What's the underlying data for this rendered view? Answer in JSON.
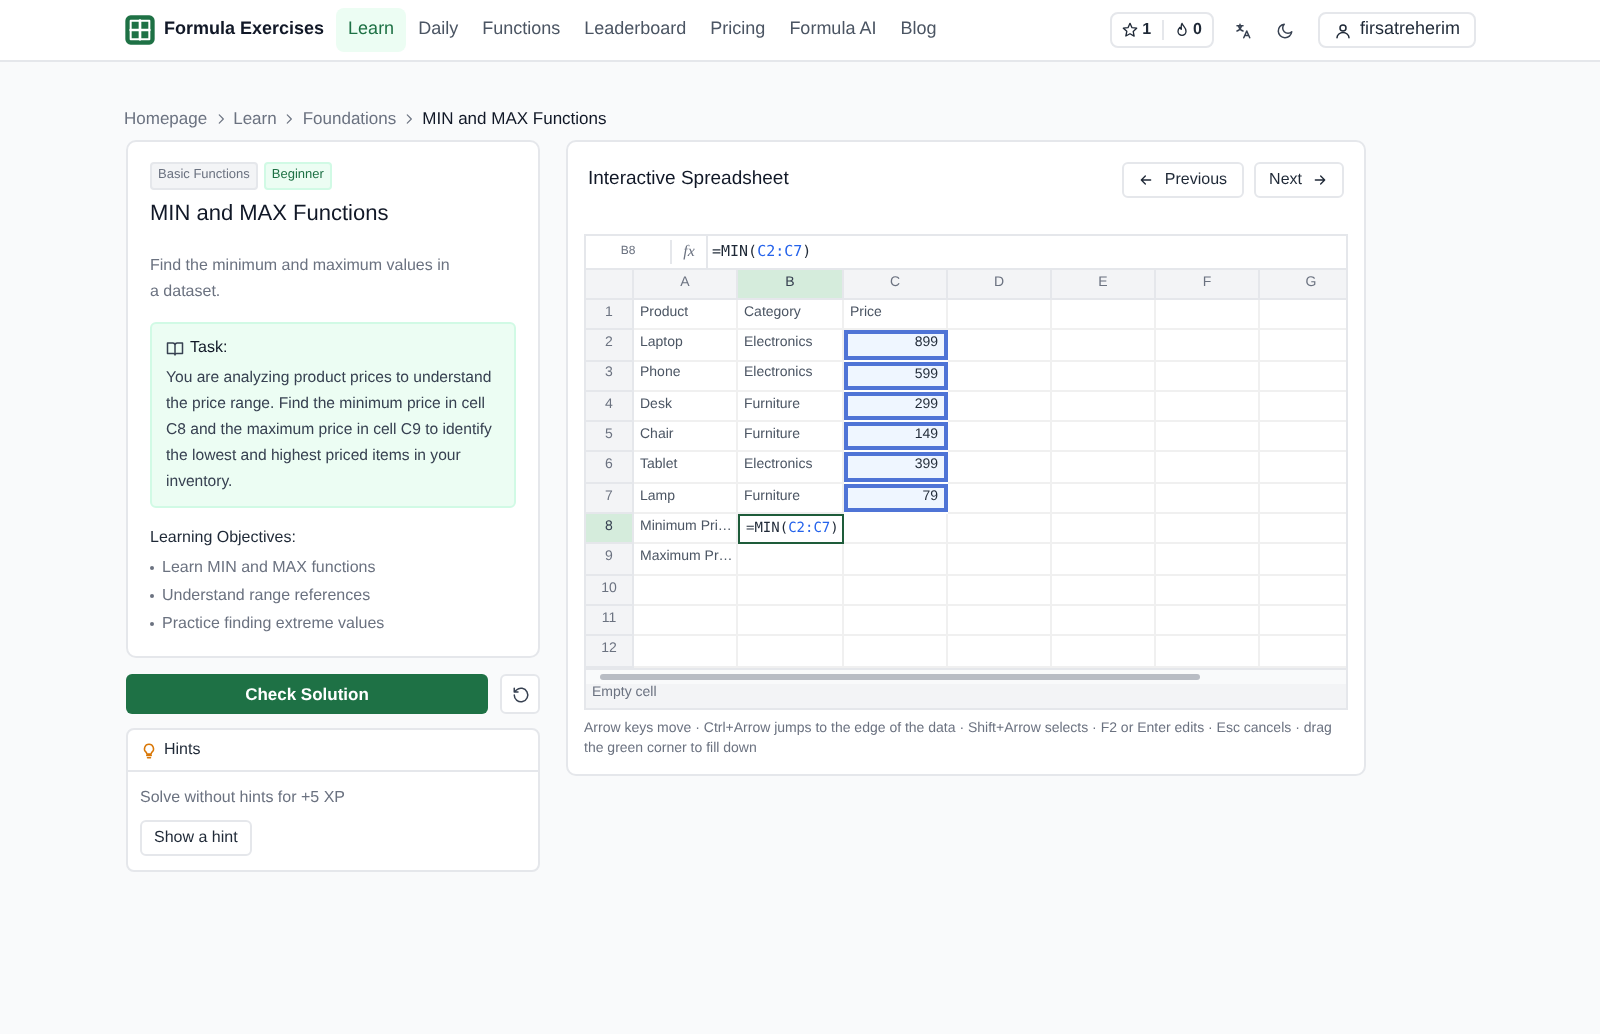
{
  "nav": {
    "brand": "Formula Exercises",
    "links": [
      {
        "label": "Learn",
        "selected": true
      },
      {
        "label": "Daily",
        "selected": false
      },
      {
        "label": "Functions",
        "selected": false
      },
      {
        "label": "Leaderboard",
        "selected": false
      },
      {
        "label": "Pricing",
        "selected": false
      },
      {
        "label": "Formula AI",
        "selected": false
      },
      {
        "label": "Blog",
        "selected": false
      }
    ],
    "stars": "1",
    "streak": "0",
    "user": "firsatreherim"
  },
  "breadcrumb": [
    "Homepage",
    "Learn",
    "Foundations",
    "MIN and MAX Functions"
  ],
  "lesson": {
    "tags": [
      {
        "label": "Basic Functions",
        "kind": "category"
      },
      {
        "label": "Beginner",
        "kind": "level"
      }
    ],
    "title": "MIN and MAX Functions",
    "description": "Find the minimum and maximum values in a dataset.",
    "task": {
      "title": "Task:",
      "text": "You are analyzing product prices to understand the price range. Find the minimum price in cell C8 and the maximum price in cell C9 to identify the lowest and highest priced items in your inventory."
    },
    "objectives_title": "Learning Objectives:",
    "objectives": [
      "Learn MIN and MAX functions",
      "Understand range references",
      "Practice finding extreme values"
    ]
  },
  "check_button": "Check Solution",
  "hints": {
    "title": "Hints",
    "note": "Solve without hints for +5 XP",
    "button": "Show a hint"
  },
  "spreadsheet": {
    "title": "Interactive Spreadsheet",
    "previous": "Previous",
    "next": "Next",
    "name_box": "B8",
    "fx": "fx",
    "formula": [
      {
        "text": "=MIN(",
        "kind": "plain"
      },
      {
        "text": "C2:C7",
        "kind": "ref"
      },
      {
        "text": ")",
        "kind": "plain"
      }
    ],
    "columns": [
      {
        "label": "A",
        "selected": false
      },
      {
        "label": "B",
        "selected": true
      },
      {
        "label": "C",
        "selected": false
      },
      {
        "label": "D",
        "selected": false
      },
      {
        "label": "E",
        "selected": false
      },
      {
        "label": "F",
        "selected": false
      },
      {
        "label": "G",
        "selected": false
      }
    ],
    "rows": [
      {
        "label": "1",
        "selected": false,
        "cells": [
          {
            "kind": "text",
            "text": "Product"
          },
          {
            "kind": "text",
            "text": "Category"
          },
          {
            "kind": "text",
            "text": "Price"
          },
          {
            "kind": "empty"
          },
          {
            "kind": "empty"
          },
          {
            "kind": "empty"
          },
          {
            "kind": "empty"
          }
        ]
      },
      {
        "label": "2",
        "selected": false,
        "cells": [
          {
            "kind": "text",
            "text": "Laptop"
          },
          {
            "kind": "text",
            "text": "Electronics"
          },
          {
            "kind": "range",
            "text": "899"
          },
          {
            "kind": "empty"
          },
          {
            "kind": "empty"
          },
          {
            "kind": "empty"
          },
          {
            "kind": "empty"
          }
        ]
      },
      {
        "label": "3",
        "selected": false,
        "cells": [
          {
            "kind": "text",
            "text": "Phone"
          },
          {
            "kind": "text",
            "text": "Electronics"
          },
          {
            "kind": "range",
            "text": "599"
          },
          {
            "kind": "empty"
          },
          {
            "kind": "empty"
          },
          {
            "kind": "empty"
          },
          {
            "kind": "empty"
          }
        ]
      },
      {
        "label": "4",
        "selected": false,
        "cells": [
          {
            "kind": "text",
            "text": "Desk"
          },
          {
            "kind": "text",
            "text": "Furniture"
          },
          {
            "kind": "range",
            "text": "299"
          },
          {
            "kind": "empty"
          },
          {
            "kind": "empty"
          },
          {
            "kind": "empty"
          },
          {
            "kind": "empty"
          }
        ]
      },
      {
        "label": "5",
        "selected": false,
        "cells": [
          {
            "kind": "text",
            "text": "Chair"
          },
          {
            "kind": "text",
            "text": "Furniture"
          },
          {
            "kind": "range",
            "text": "149"
          },
          {
            "kind": "empty"
          },
          {
            "kind": "empty"
          },
          {
            "kind": "empty"
          },
          {
            "kind": "empty"
          }
        ]
      },
      {
        "label": "6",
        "selected": false,
        "cells": [
          {
            "kind": "text",
            "text": "Tablet"
          },
          {
            "kind": "text",
            "text": "Electronics"
          },
          {
            "kind": "range",
            "text": "399"
          },
          {
            "kind": "empty"
          },
          {
            "kind": "empty"
          },
          {
            "kind": "empty"
          },
          {
            "kind": "empty"
          }
        ]
      },
      {
        "label": "7",
        "selected": false,
        "cells": [
          {
            "kind": "text",
            "text": "Lamp"
          },
          {
            "kind": "text",
            "text": "Furniture"
          },
          {
            "kind": "range",
            "text": "79"
          },
          {
            "kind": "empty"
          },
          {
            "kind": "empty"
          },
          {
            "kind": "empty"
          },
          {
            "kind": "empty"
          }
        ]
      },
      {
        "label": "8",
        "selected": true,
        "cells": [
          {
            "kind": "text",
            "text": "Minimum Pri…"
          },
          {
            "kind": "active",
            "parts": [
              {
                "text": "=MIN(",
                "kind": "plain"
              },
              {
                "text": "C2:C7",
                "kind": "ref"
              },
              {
                "text": ")",
                "kind": "plain"
              }
            ]
          },
          {
            "kind": "empty"
          },
          {
            "kind": "empty"
          },
          {
            "kind": "empty"
          },
          {
            "kind": "empty"
          },
          {
            "kind": "empty"
          }
        ]
      },
      {
        "label": "9",
        "selected": false,
        "cells": [
          {
            "kind": "text",
            "text": "Maximum Pr…"
          },
          {
            "kind": "empty"
          },
          {
            "kind": "empty"
          },
          {
            "kind": "empty"
          },
          {
            "kind": "empty"
          },
          {
            "kind": "empty"
          },
          {
            "kind": "empty"
          }
        ]
      },
      {
        "label": "10",
        "selected": false,
        "cells": [
          {
            "kind": "empty"
          },
          {
            "kind": "empty"
          },
          {
            "kind": "empty"
          },
          {
            "kind": "empty"
          },
          {
            "kind": "empty"
          },
          {
            "kind": "empty"
          },
          {
            "kind": "empty"
          }
        ]
      },
      {
        "label": "11",
        "selected": false,
        "cells": [
          {
            "kind": "empty"
          },
          {
            "kind": "empty"
          },
          {
            "kind": "empty"
          },
          {
            "kind": "empty"
          },
          {
            "kind": "empty"
          },
          {
            "kind": "empty"
          },
          {
            "kind": "empty"
          }
        ]
      },
      {
        "label": "12",
        "selected": false,
        "cells": [
          {
            "kind": "empty"
          },
          {
            "kind": "empty"
          },
          {
            "kind": "empty"
          },
          {
            "kind": "empty"
          },
          {
            "kind": "empty"
          },
          {
            "kind": "empty"
          },
          {
            "kind": "empty"
          }
        ]
      }
    ],
    "status": "Empty cell",
    "help": "Arrow keys move · Ctrl+Arrow jumps to the edge of the data · Shift+Arrow selects · F2 or Enter edits · Esc cancels · drag the green corner to fill down"
  }
}
